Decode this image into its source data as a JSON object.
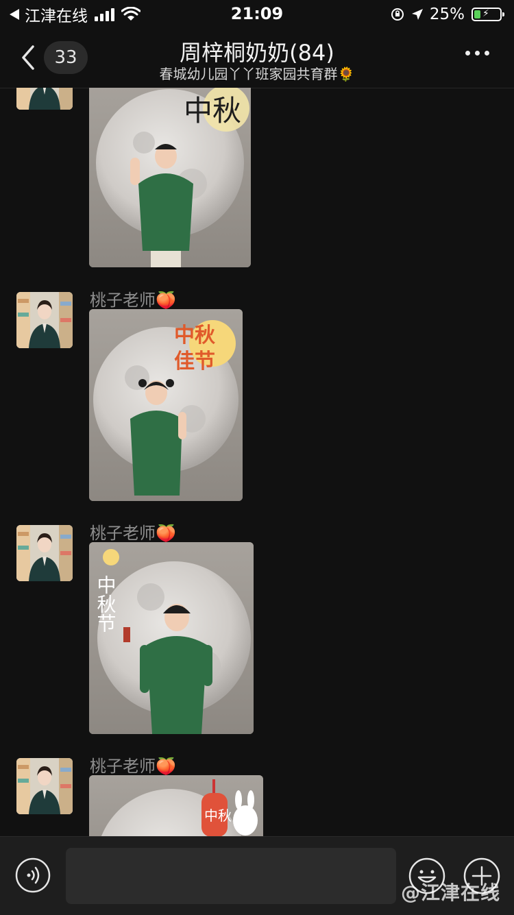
{
  "status_bar": {
    "carrier": "江津在线",
    "time": "21:09",
    "battery_pct": "25%",
    "battery_level": 0.25
  },
  "header": {
    "back_count": "33",
    "title": "周梓桐奶奶(84)",
    "subtitle": "春城幼儿园丫丫班家园共育群🌻"
  },
  "messages": [
    {
      "sender": "",
      "image": "photo-mid-autumn-boy-waving"
    },
    {
      "sender": "桃子老师🍑",
      "image": "photo-mid-autumn-girl"
    },
    {
      "sender": "桃子老师🍑",
      "image": "photo-mid-autumn-boy"
    },
    {
      "sender": "桃子老师🍑",
      "image": "photo-mid-autumn-lantern"
    }
  ],
  "photo_captions": {
    "caption_1": "中秋",
    "caption_2a": "中秋",
    "caption_2b": "佳节",
    "caption_3": "中秋节",
    "caption_4": "中秋"
  },
  "input": {
    "value": "",
    "placeholder": ""
  },
  "watermark": "@江津在线",
  "colors": {
    "background": "#111111",
    "header_text": "#f2f2f2",
    "sender_text": "#8e8e8e",
    "input_bar": "#1e1e1e",
    "shirt_green": "#2f6f45"
  }
}
